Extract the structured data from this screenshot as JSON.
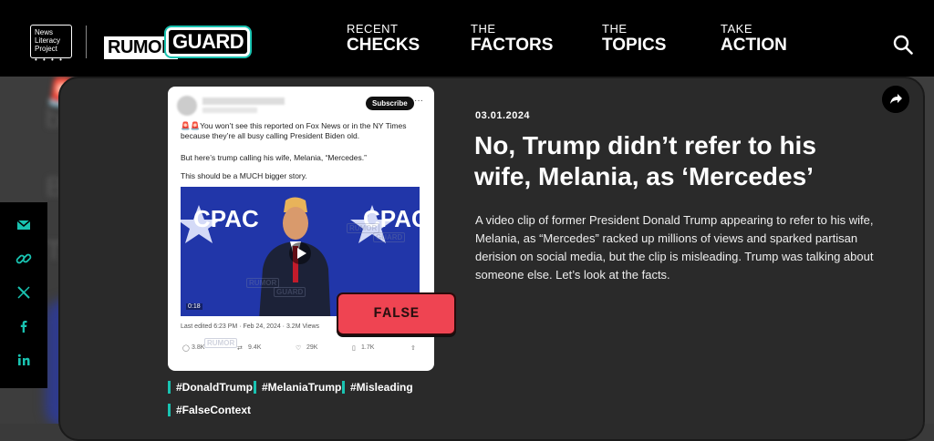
{
  "brand": {
    "nlp_logo_lines": [
      "News",
      "Literacy",
      "Project"
    ],
    "rumor_label": "RUMOR",
    "guard_label": "GUARD"
  },
  "nav": [
    {
      "small": "RECENT",
      "large": "CHECKS"
    },
    {
      "small": "THE",
      "large": "FACTORS"
    },
    {
      "small": "THE",
      "large": "TOPICS"
    },
    {
      "small": "TAKE",
      "large": "ACTION"
    }
  ],
  "icons": {
    "search": "search-icon",
    "share": "share-arrow-icon",
    "email": "mail-icon",
    "link": "link-icon",
    "x": "x-icon",
    "facebook": "facebook-icon",
    "linkedin": "linkedin-icon"
  },
  "colors": {
    "accent": "#19c3b1",
    "false_badge": "#ef4452",
    "header_bg": "#000000"
  },
  "article": {
    "date": "03.01.2024",
    "title": "No, Trump didn’t refer to his wife, Melania, as ‘Mercedes’",
    "summary": "A video clip of former President Donald Trump appearing to refer to his wife, Melania, as “Mercedes” racked up millions of views and sparked partisan derision on social media, but the clip is misleading. Trump was talking about someone else. Let’s look at the facts.",
    "rating": "FALSE",
    "tags": [
      "#DonaldTrump",
      "#MelaniaTrump",
      "#Misleading",
      "#FalseContext"
    ]
  },
  "tweet": {
    "subscribe_label": "Subscribe",
    "more": "···",
    "line1": "🚨🚨You won’t see this reported on Fox News or in the NY Times because they’re all busy calling President Biden old.",
    "line2": "But here’s trump calling his wife, Melania, “Mercedes.”",
    "line3": "This should be a MUCH bigger story.",
    "video_text": "CPAC",
    "video_time": "0:18",
    "meta": "Last edited 6:23 PM · Feb 24, 2024 · 3.2M Views",
    "replies": "3.8K",
    "reposts": "9.4K",
    "likes": "29K",
    "bookmarks": "1.7K",
    "watermark_top": "RUMOR",
    "watermark_bottom": "GUARD"
  },
  "social_rail": [
    "mail-icon",
    "link-icon",
    "x-icon",
    "facebook-icon",
    "linkedin-icon"
  ]
}
